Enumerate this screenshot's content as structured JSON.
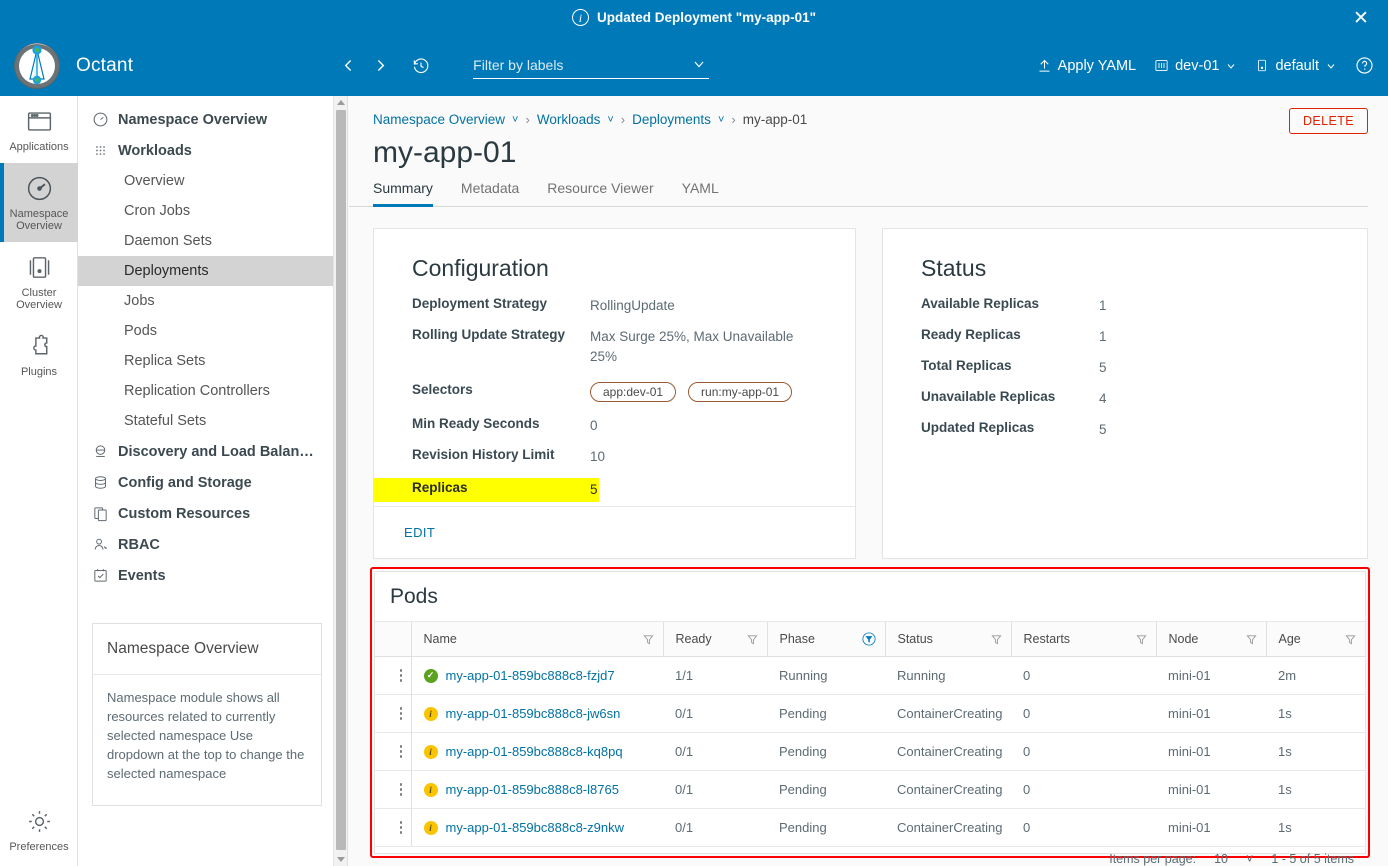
{
  "notification": {
    "icon": "info-circle-icon",
    "message": "Updated Deployment \"my-app-01\"",
    "close_label": "✕"
  },
  "header": {
    "brand": "Octant",
    "back_icon": "chevron-left-icon",
    "forward_icon": "chevron-right-icon",
    "history_icon": "history-icon",
    "filter": {
      "placeholder": "Filter by labels",
      "value": ""
    },
    "apply_yaml": "Apply YAML",
    "cluster": "dev-01",
    "namespace": "default",
    "help_icon": "help-circle-icon",
    "accent": "#0079b8"
  },
  "rail": {
    "items": [
      {
        "label": "Applications",
        "icon": "window-icon",
        "active": false
      },
      {
        "label": "Namespace Overview",
        "icon": "dashboard-icon",
        "active": true
      },
      {
        "label": "Cluster Overview",
        "icon": "cluster-icon",
        "active": false
      },
      {
        "label": "Plugins",
        "icon": "puzzle-icon",
        "active": false
      }
    ],
    "preferences": {
      "label": "Preferences",
      "icon": "gear-icon"
    }
  },
  "tree": {
    "items": [
      {
        "label": "Namespace Overview",
        "level": "top",
        "icon": "dashboard-icon",
        "active": false
      },
      {
        "label": "Workloads",
        "level": "top",
        "icon": "grid-dots-icon",
        "active": false
      },
      {
        "label": "Overview",
        "level": "sub",
        "active": false
      },
      {
        "label": "Cron Jobs",
        "level": "sub",
        "active": false
      },
      {
        "label": "Daemon Sets",
        "level": "sub",
        "active": false
      },
      {
        "label": "Deployments",
        "level": "sub",
        "active": true
      },
      {
        "label": "Jobs",
        "level": "sub",
        "active": false
      },
      {
        "label": "Pods",
        "level": "sub",
        "active": false
      },
      {
        "label": "Replica Sets",
        "level": "sub",
        "active": false
      },
      {
        "label": "Replication Controllers",
        "level": "sub",
        "active": false
      },
      {
        "label": "Stateful Sets",
        "level": "sub",
        "active": false
      },
      {
        "label": "Discovery and Load Balan…",
        "level": "top",
        "icon": "network-icon",
        "active": false
      },
      {
        "label": "Config and Storage",
        "level": "top",
        "icon": "storage-icon",
        "active": false
      },
      {
        "label": "Custom Resources",
        "level": "top",
        "icon": "copy-icon",
        "active": false
      },
      {
        "label": "RBAC",
        "level": "top",
        "icon": "user-key-icon",
        "active": false
      },
      {
        "label": "Events",
        "level": "top",
        "icon": "event-icon",
        "active": false
      }
    ],
    "info_card": {
      "title": "Namespace Overview",
      "body": "Namespace module shows all resources related to currently selected namespace Use dropdown at the top to change the selected namespace"
    }
  },
  "breadcrumb": {
    "items": [
      {
        "label": "Namespace Overview",
        "link": true,
        "caret": true
      },
      {
        "label": "Workloads",
        "link": true,
        "caret": true
      },
      {
        "label": "Deployments",
        "link": true,
        "caret": true
      },
      {
        "label": "my-app-01",
        "link": false,
        "caret": false
      }
    ],
    "separator": "›"
  },
  "page": {
    "title": "my-app-01",
    "delete_label": "DELETE",
    "tabs": [
      {
        "label": "Summary",
        "active": true
      },
      {
        "label": "Metadata",
        "active": false
      },
      {
        "label": "Resource Viewer",
        "active": false
      },
      {
        "label": "YAML",
        "active": false
      }
    ]
  },
  "configuration": {
    "title": "Configuration",
    "rows": [
      {
        "key": "Deployment Strategy",
        "value": "RollingUpdate"
      },
      {
        "key": "Rolling Update Strategy",
        "value": "Max Surge 25%, Max Unavailable 25%"
      },
      {
        "key": "Min Ready Seconds",
        "value": "0"
      },
      {
        "key": "Revision History Limit",
        "value": "10"
      }
    ],
    "selectors_key": "Selectors",
    "selectors": [
      "app:dev-01",
      "run:my-app-01"
    ],
    "replicas_key": "Replicas",
    "replicas_value": "5",
    "highlight_color": "#ffff00",
    "edit_label": "EDIT"
  },
  "status": {
    "title": "Status",
    "rows": [
      {
        "key": "Available Replicas",
        "value": "1"
      },
      {
        "key": "Ready Replicas",
        "value": "1"
      },
      {
        "key": "Total Replicas",
        "value": "5"
      },
      {
        "key": "Unavailable Replicas",
        "value": "4"
      },
      {
        "key": "Updated Replicas",
        "value": "5"
      }
    ]
  },
  "pods": {
    "title": "Pods",
    "annotation_color": "#fb0000",
    "columns": [
      {
        "label": "",
        "filter": false
      },
      {
        "label": "Name",
        "filter": true,
        "filter_active": false
      },
      {
        "label": "Ready",
        "filter": true,
        "filter_active": false
      },
      {
        "label": "Phase",
        "filter": true,
        "filter_active": true
      },
      {
        "label": "Status",
        "filter": true,
        "filter_active": false
      },
      {
        "label": "Restarts",
        "filter": true,
        "filter_active": false
      },
      {
        "label": "Node",
        "filter": true,
        "filter_active": false
      },
      {
        "label": "Age",
        "filter": true,
        "filter_active": false
      }
    ],
    "rows": [
      {
        "icon": "status-ok-icon",
        "name": "my-app-01-859bc888c8-fzjd7",
        "ready": "1/1",
        "phase": "Running",
        "status": "Running",
        "restarts": "0",
        "node": "mini-01",
        "age": "2m"
      },
      {
        "icon": "status-warning-icon",
        "name": "my-app-01-859bc888c8-jw6sn",
        "ready": "0/1",
        "phase": "Pending",
        "status": "ContainerCreating",
        "restarts": "0",
        "node": "mini-01",
        "age": "1s"
      },
      {
        "icon": "status-warning-icon",
        "name": "my-app-01-859bc888c8-kq8pq",
        "ready": "0/1",
        "phase": "Pending",
        "status": "ContainerCreating",
        "restarts": "0",
        "node": "mini-01",
        "age": "1s"
      },
      {
        "icon": "status-warning-icon",
        "name": "my-app-01-859bc888c8-l8765",
        "ready": "0/1",
        "phase": "Pending",
        "status": "ContainerCreating",
        "restarts": "0",
        "node": "mini-01",
        "age": "1s"
      },
      {
        "icon": "status-warning-icon",
        "name": "my-app-01-859bc888c8-z9nkw",
        "ready": "0/1",
        "phase": "Pending",
        "status": "ContainerCreating",
        "restarts": "0",
        "node": "mini-01",
        "age": "1s"
      }
    ],
    "pagination": {
      "per_page_label": "Items per page:",
      "per_page_value": "10",
      "range_label": "1 - 5 of 5 items"
    }
  }
}
